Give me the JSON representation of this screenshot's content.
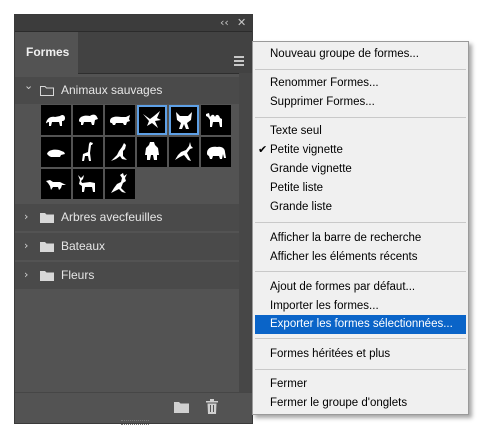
{
  "panel": {
    "collapse_glyph": "‹‹",
    "close_glyph": "✕",
    "tab_label": "Formes",
    "groups": [
      {
        "label": "Animaux sauvages",
        "expanded": true
      },
      {
        "label": "Arbres avecfeuilles",
        "expanded": false
      },
      {
        "label": "Bateaux",
        "expanded": false
      },
      {
        "label": "Fleurs",
        "expanded": false
      }
    ],
    "chevron_expanded": "⌄",
    "chevron_collapsed": "›",
    "shapes": [
      {
        "icon": "lion-icon",
        "selected": false
      },
      {
        "icon": "bear-icon",
        "selected": false
      },
      {
        "icon": "rhino-icon",
        "selected": false
      },
      {
        "icon": "bird-icon",
        "selected": true
      },
      {
        "icon": "wolf-icon",
        "selected": true
      },
      {
        "icon": "camel-icon",
        "selected": false
      },
      {
        "icon": "mole-icon",
        "selected": false
      },
      {
        "icon": "giraffe-icon",
        "selected": false
      },
      {
        "icon": "kangaroo-icon",
        "selected": false
      },
      {
        "icon": "gorilla-icon",
        "selected": false
      },
      {
        "icon": "gazelle-icon",
        "selected": false
      },
      {
        "icon": "elephant-icon",
        "selected": false
      },
      {
        "icon": "fox-icon",
        "selected": false
      },
      {
        "icon": "moose-icon",
        "selected": false
      },
      {
        "icon": "deer-icon",
        "selected": false
      }
    ],
    "footer_icons": [
      "new-group-folder-icon",
      "trash-icon"
    ]
  },
  "menu": {
    "items": [
      {
        "label": "Nouveau groupe de formes...",
        "checked": false,
        "highlight": false
      },
      {
        "label": "Renommer Formes...",
        "checked": false,
        "highlight": false
      },
      {
        "label": "Supprimer Formes...",
        "checked": false,
        "highlight": false
      },
      {
        "label": "Texte seul",
        "checked": false,
        "highlight": false
      },
      {
        "label": "Petite vignette",
        "checked": true,
        "highlight": false
      },
      {
        "label": "Grande vignette",
        "checked": false,
        "highlight": false
      },
      {
        "label": "Petite liste",
        "checked": false,
        "highlight": false
      },
      {
        "label": "Grande liste",
        "checked": false,
        "highlight": false
      },
      {
        "label": "Afficher la barre de recherche",
        "checked": false,
        "highlight": false
      },
      {
        "label": "Afficher les éléments récents",
        "checked": false,
        "highlight": false
      },
      {
        "label": "Ajout de formes par défaut...",
        "checked": false,
        "highlight": false
      },
      {
        "label": "Importer les formes...",
        "checked": false,
        "highlight": false
      },
      {
        "label": "Exporter les formes sélectionnées...",
        "checked": false,
        "highlight": true
      },
      {
        "label": "Formes héritées et plus",
        "checked": false,
        "highlight": false
      },
      {
        "label": "Fermer",
        "checked": false,
        "highlight": false
      },
      {
        "label": "Fermer le groupe d'onglets",
        "checked": false,
        "highlight": false
      }
    ],
    "check_glyph": "✔"
  },
  "colors": {
    "panel_bg": "#535353",
    "selection_border": "#5ea0e6",
    "menu_highlight": "#0a64c8"
  }
}
